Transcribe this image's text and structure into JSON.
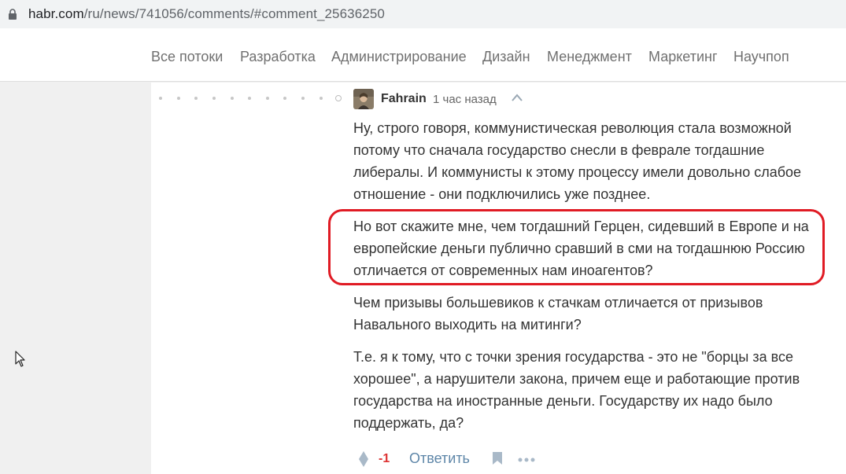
{
  "browser": {
    "url_host": "habr.com",
    "url_path": "/ru/news/741056/comments/#comment_25636250"
  },
  "nav": {
    "items": [
      "Все потоки",
      "Разработка",
      "Администрирование",
      "Дизайн",
      "Менеджмент",
      "Маркетинг",
      "Научпоп"
    ]
  },
  "comment": {
    "author": "Fahrain",
    "time": "1 час назад",
    "paragraphs": [
      "Ну, строго говоря, коммунистическая революция стала возможной потому что сначала государство снесли в феврале тогдашние либералы. И коммунисты к этому процессу имели довольно слабое отношение - они подключились уже позднее.",
      "Но вот скажите мне, чем тогдашний Герцен, сидевший в Европе и на европейские деньги публично сравший в сми на тогдашнюю Россию отличается от современных нам иноагентов?",
      "Чем призывы большевиков к стачкам отличается от призывов Навального выходить на митинги?",
      "Т.е. я к тому, что с точки зрения государства - это не \"борцы за все хорошее\", а нарушители закона, причем еще и работающие против государства на иностранные деньги. Государству их надо было поддержать, да?"
    ],
    "score": "-1",
    "reply_label": "Ответить"
  },
  "colors": {
    "highlight": "#e01b24",
    "score": "#dd3333",
    "link": "#5e86a8",
    "page_bg": "#f0f0f0"
  },
  "icons": [
    "lock-icon",
    "chevron-up-icon",
    "vote-icon",
    "bookmark-icon",
    "more-icon",
    "cursor-icon"
  ]
}
